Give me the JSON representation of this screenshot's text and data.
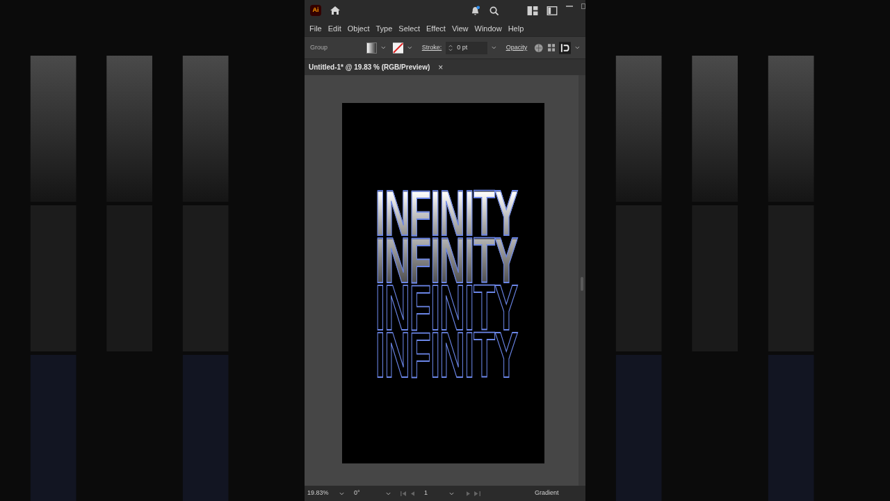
{
  "app": {
    "logo": "Ai"
  },
  "menu": [
    {
      "label": "File"
    },
    {
      "label": "Edit"
    },
    {
      "label": "Object"
    },
    {
      "label": "Type"
    },
    {
      "label": "Select"
    },
    {
      "label": "Effect"
    },
    {
      "label": "View"
    },
    {
      "label": "Window"
    },
    {
      "label": "Help"
    }
  ],
  "control_bar": {
    "selection": "Group",
    "stroke_label": "Stroke:",
    "stroke_value": "0 pt",
    "opacity_label": "Opacity"
  },
  "document_tab": {
    "title": "Untitled-1* @ 19.83 % (RGB/Preview)",
    "close": "×"
  },
  "artwork": [
    {
      "text": "INFINITY",
      "kind": "bright"
    },
    {
      "text": "INFINITY",
      "kind": "fade"
    },
    {
      "text": "INFINITY",
      "kind": "outline"
    },
    {
      "text": "INFINITY",
      "kind": "outline"
    }
  ],
  "status_bar": {
    "zoom": "19.83%",
    "rotation": "0°",
    "artboard": "1",
    "tool": "Gradient"
  }
}
